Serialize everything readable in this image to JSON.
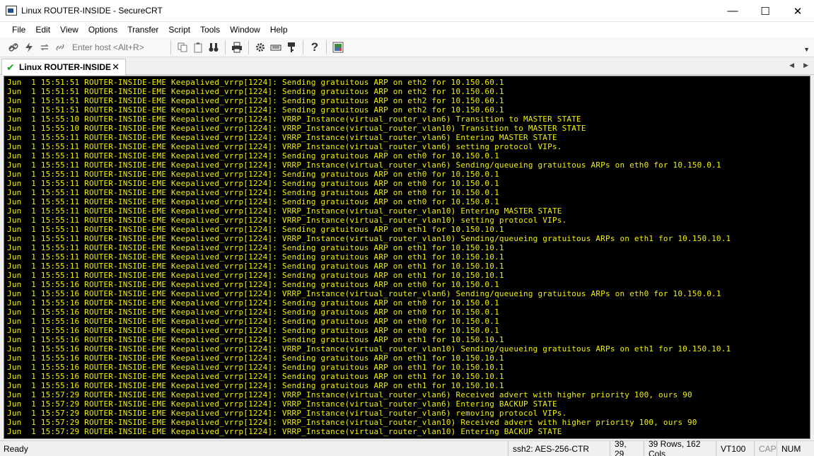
{
  "window": {
    "title": "Linux ROUTER-INSIDE - SecureCRT",
    "minimize": "—",
    "maximize": "☐",
    "close": "✕"
  },
  "menu": [
    "File",
    "Edit",
    "View",
    "Options",
    "Transfer",
    "Script",
    "Tools",
    "Window",
    "Help"
  ],
  "toolbar": {
    "enter_host_placeholder": "Enter host <Alt+R>"
  },
  "tab": {
    "label": "Linux ROUTER-INSIDE",
    "close": "✕"
  },
  "terminal": {
    "text_color": "#f0f000",
    "background": "#000000",
    "lines": [
      "Jun  1 15:51:51 ROUTER-INSIDE-EME Keepalived_vrrp[1224]: Sending gratuitous ARP on eth2 for 10.150.60.1",
      "Jun  1 15:51:51 ROUTER-INSIDE-EME Keepalived_vrrp[1224]: Sending gratuitous ARP on eth2 for 10.150.60.1",
      "Jun  1 15:51:51 ROUTER-INSIDE-EME Keepalived_vrrp[1224]: Sending gratuitous ARP on eth2 for 10.150.60.1",
      "Jun  1 15:51:51 ROUTER-INSIDE-EME Keepalived_vrrp[1224]: Sending gratuitous ARP on eth2 for 10.150.60.1",
      "Jun  1 15:55:10 ROUTER-INSIDE-EME Keepalived_vrrp[1224]: VRRP_Instance(virtual_router_vlan6) Transition to MASTER STATE",
      "Jun  1 15:55:10 ROUTER-INSIDE-EME Keepalived_vrrp[1224]: VRRP_Instance(virtual_router_vlan10) Transition to MASTER STATE",
      "Jun  1 15:55:11 ROUTER-INSIDE-EME Keepalived_vrrp[1224]: VRRP_Instance(virtual_router_vlan6) Entering MASTER STATE",
      "Jun  1 15:55:11 ROUTER-INSIDE-EME Keepalived_vrrp[1224]: VRRP_Instance(virtual_router_vlan6) setting protocol VIPs.",
      "Jun  1 15:55:11 ROUTER-INSIDE-EME Keepalived_vrrp[1224]: Sending gratuitous ARP on eth0 for 10.150.0.1",
      "Jun  1 15:55:11 ROUTER-INSIDE-EME Keepalived_vrrp[1224]: VRRP_Instance(virtual_router_vlan6) Sending/queueing gratuitous ARPs on eth0 for 10.150.0.1",
      "Jun  1 15:55:11 ROUTER-INSIDE-EME Keepalived_vrrp[1224]: Sending gratuitous ARP on eth0 for 10.150.0.1",
      "Jun  1 15:55:11 ROUTER-INSIDE-EME Keepalived_vrrp[1224]: Sending gratuitous ARP on eth0 for 10.150.0.1",
      "Jun  1 15:55:11 ROUTER-INSIDE-EME Keepalived_vrrp[1224]: Sending gratuitous ARP on eth0 for 10.150.0.1",
      "Jun  1 15:55:11 ROUTER-INSIDE-EME Keepalived_vrrp[1224]: Sending gratuitous ARP on eth0 for 10.150.0.1",
      "Jun  1 15:55:11 ROUTER-INSIDE-EME Keepalived_vrrp[1224]: VRRP_Instance(virtual_router_vlan10) Entering MASTER STATE",
      "Jun  1 15:55:11 ROUTER-INSIDE-EME Keepalived_vrrp[1224]: VRRP_Instance(virtual_router_vlan10) setting protocol VIPs.",
      "Jun  1 15:55:11 ROUTER-INSIDE-EME Keepalived_vrrp[1224]: Sending gratuitous ARP on eth1 for 10.150.10.1",
      "Jun  1 15:55:11 ROUTER-INSIDE-EME Keepalived_vrrp[1224]: VRRP_Instance(virtual_router_vlan10) Sending/queueing gratuitous ARPs on eth1 for 10.150.10.1",
      "Jun  1 15:55:11 ROUTER-INSIDE-EME Keepalived_vrrp[1224]: Sending gratuitous ARP on eth1 for 10.150.10.1",
      "Jun  1 15:55:11 ROUTER-INSIDE-EME Keepalived_vrrp[1224]: Sending gratuitous ARP on eth1 for 10.150.10.1",
      "Jun  1 15:55:11 ROUTER-INSIDE-EME Keepalived_vrrp[1224]: Sending gratuitous ARP on eth1 for 10.150.10.1",
      "Jun  1 15:55:11 ROUTER-INSIDE-EME Keepalived_vrrp[1224]: Sending gratuitous ARP on eth1 for 10.150.10.1",
      "Jun  1 15:55:16 ROUTER-INSIDE-EME Keepalived_vrrp[1224]: Sending gratuitous ARP on eth0 for 10.150.0.1",
      "Jun  1 15:55:16 ROUTER-INSIDE-EME Keepalived_vrrp[1224]: VRRP_Instance(virtual_router_vlan6) Sending/queueing gratuitous ARPs on eth0 for 10.150.0.1",
      "Jun  1 15:55:16 ROUTER-INSIDE-EME Keepalived_vrrp[1224]: Sending gratuitous ARP on eth0 for 10.150.0.1",
      "Jun  1 15:55:16 ROUTER-INSIDE-EME Keepalived_vrrp[1224]: Sending gratuitous ARP on eth0 for 10.150.0.1",
      "Jun  1 15:55:16 ROUTER-INSIDE-EME Keepalived_vrrp[1224]: Sending gratuitous ARP on eth0 for 10.150.0.1",
      "Jun  1 15:55:16 ROUTER-INSIDE-EME Keepalived_vrrp[1224]: Sending gratuitous ARP on eth0 for 10.150.0.1",
      "Jun  1 15:55:16 ROUTER-INSIDE-EME Keepalived_vrrp[1224]: Sending gratuitous ARP on eth1 for 10.150.10.1",
      "Jun  1 15:55:16 ROUTER-INSIDE-EME Keepalived_vrrp[1224]: VRRP_Instance(virtual_router_vlan10) Sending/queueing gratuitous ARPs on eth1 for 10.150.10.1",
      "Jun  1 15:55:16 ROUTER-INSIDE-EME Keepalived_vrrp[1224]: Sending gratuitous ARP on eth1 for 10.150.10.1",
      "Jun  1 15:55:16 ROUTER-INSIDE-EME Keepalived_vrrp[1224]: Sending gratuitous ARP on eth1 for 10.150.10.1",
      "Jun  1 15:55:16 ROUTER-INSIDE-EME Keepalived_vrrp[1224]: Sending gratuitous ARP on eth1 for 10.150.10.1",
      "Jun  1 15:55:16 ROUTER-INSIDE-EME Keepalived_vrrp[1224]: Sending gratuitous ARP on eth1 for 10.150.10.1",
      "Jun  1 15:57:29 ROUTER-INSIDE-EME Keepalived_vrrp[1224]: VRRP_Instance(virtual_router_vlan6) Received advert with higher priority 100, ours 90",
      "Jun  1 15:57:29 ROUTER-INSIDE-EME Keepalived_vrrp[1224]: VRRP_Instance(virtual_router_vlan6) Entering BACKUP STATE",
      "Jun  1 15:57:29 ROUTER-INSIDE-EME Keepalived_vrrp[1224]: VRRP_Instance(virtual_router_vlan6) removing protocol VIPs.",
      "Jun  1 15:57:29 ROUTER-INSIDE-EME Keepalived_vrrp[1224]: VRRP_Instance(virtual_router_vlan10) Received advert with higher priority 100, ours 90",
      "Jun  1 15:57:29 ROUTER-INSIDE-EME Keepalived_vrrp[1224]: VRRP_Instance(virtual_router_vlan10) Entering BACKUP STATE"
    ]
  },
  "status": {
    "ready": "Ready",
    "connection": "ssh2: AES-256-CTR",
    "cursor": "39,  29",
    "size": "39 Rows, 162 Cols",
    "emulation": "VT100",
    "cap": "CAP",
    "num": "NUM"
  }
}
